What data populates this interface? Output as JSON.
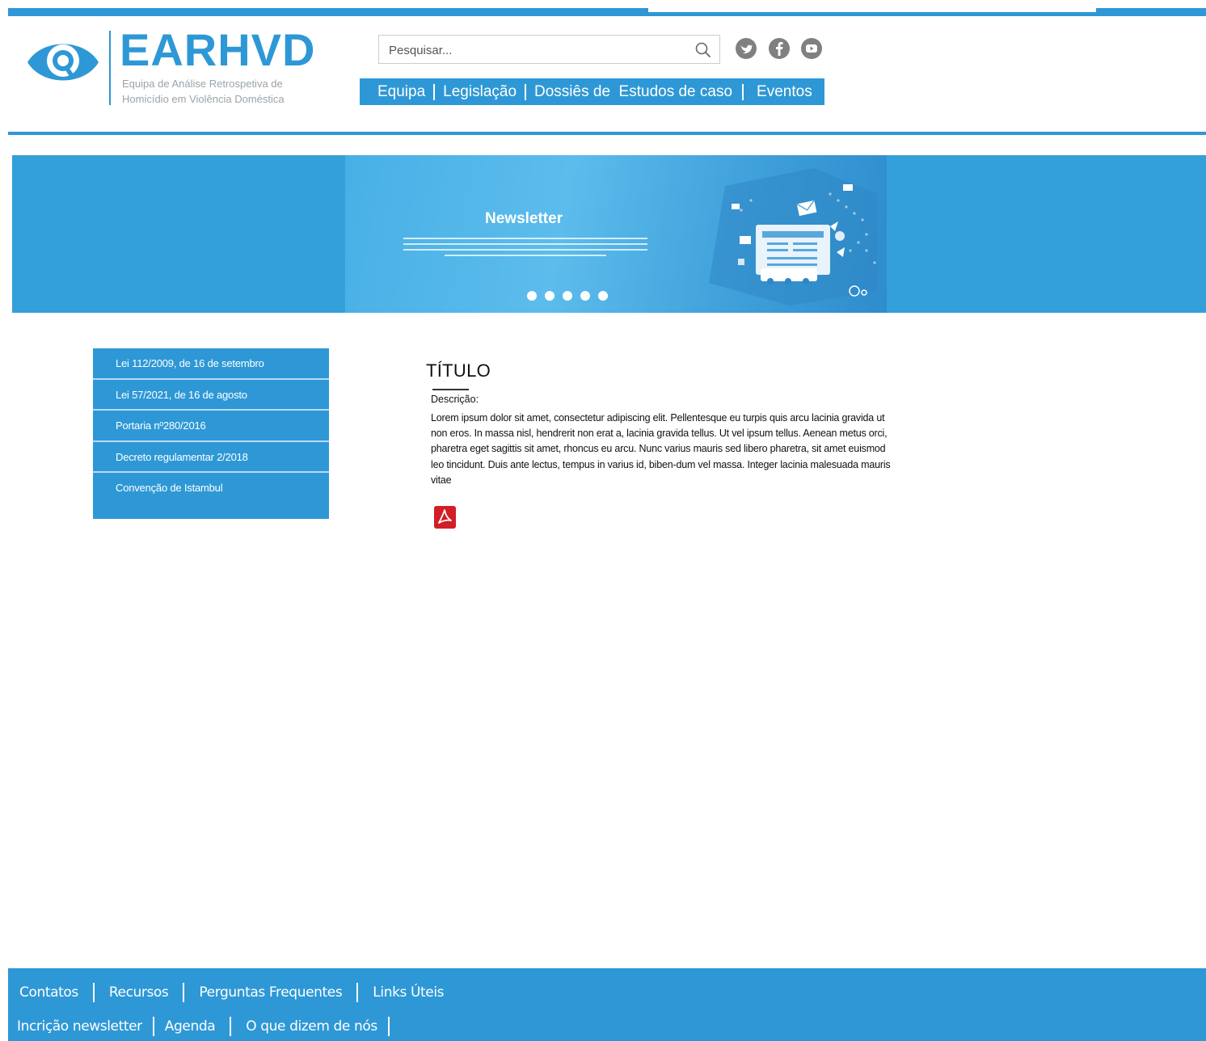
{
  "logo": {
    "title": "EARHVD",
    "subtitle_1": "Equipa de Análise Retrospetiva de",
    "subtitle_2": "Homicídio em Violência Doméstica"
  },
  "search": {
    "placeholder": "Pesquisar..."
  },
  "social": [
    "twitter-icon",
    "facebook-icon",
    "youtube-icon"
  ],
  "nav": {
    "items": [
      "Equipa",
      "Legislação",
      "Dossiês de  Estudos de caso",
      "Eventos"
    ]
  },
  "banner": {
    "title": "Newsletter",
    "slides_count": 5
  },
  "sidebar": {
    "items": [
      "Lei 112/2009, de 16 de setembro",
      "Lei 57/2021, de 16 de agosto",
      "Portaria nº280/2016",
      "Decreto regulamentar 2/2018",
      "Convenção de Istambul"
    ]
  },
  "content": {
    "title": "TÍTULO",
    "description_label": "Descrição:",
    "body": "Lorem ipsum dolor sit amet, consectetur adipiscing elit. Pellentesque eu turpis quis arcu lacinia gravida ut non eros. In massa nisl, hendrerit non erat a, lacinia gravida tellus. Ut vel ipsum tellus. Aenean metus orci, pharetra eget sagittis sit amet, rhoncus eu arcu. Nunc varius mauris sed libero pharetra, sit amet euismod leo tincidunt. Duis ante lectus, tempus in varius id, biben-dum vel massa. Integer lacinia malesuada mauris vitae",
    "attachment_icon": "pdf-icon"
  },
  "footer": {
    "row1": [
      "Contatos",
      "Recursos",
      "Perguntas Frequentes",
      "Links Úteis"
    ],
    "row2": [
      "Incrição newsletter",
      "Agenda",
      "O que dizem de nós"
    ]
  },
  "colors": {
    "brand": "#2e98d6",
    "pdf": "#d11f25"
  }
}
